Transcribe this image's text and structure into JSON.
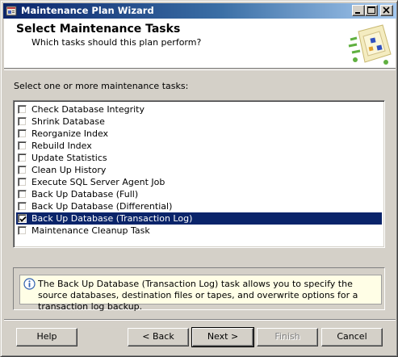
{
  "window": {
    "title": "Maintenance Plan Wizard"
  },
  "header": {
    "title": "Select Maintenance Tasks",
    "subtitle": "Which tasks should this plan perform?"
  },
  "task_list": {
    "label": "Select one or more maintenance tasks:",
    "items": [
      {
        "label": "Check Database Integrity",
        "checked": false,
        "selected": false
      },
      {
        "label": "Shrink Database",
        "checked": false,
        "selected": false
      },
      {
        "label": "Reorganize Index",
        "checked": false,
        "selected": false
      },
      {
        "label": "Rebuild Index",
        "checked": false,
        "selected": false
      },
      {
        "label": "Update Statistics",
        "checked": false,
        "selected": false
      },
      {
        "label": "Clean Up History",
        "checked": false,
        "selected": false
      },
      {
        "label": "Execute SQL Server Agent Job",
        "checked": false,
        "selected": false
      },
      {
        "label": "Back Up Database (Full)",
        "checked": false,
        "selected": false
      },
      {
        "label": "Back Up Database (Differential)",
        "checked": false,
        "selected": false
      },
      {
        "label": "Back Up Database (Transaction Log)",
        "checked": true,
        "selected": true
      },
      {
        "label": "Maintenance Cleanup Task",
        "checked": false,
        "selected": false
      }
    ]
  },
  "description": {
    "icon": "info-icon",
    "text": "The Back Up Database (Transaction Log) task allows you to specify the source databases, destination files or tapes, and overwrite options for a transaction log backup."
  },
  "buttons": {
    "help": "Help",
    "back": "< Back",
    "next": "Next >",
    "finish": "Finish",
    "cancel": "Cancel"
  },
  "colors": {
    "title_bar_start": "#0a246a",
    "title_bar_end": "#a6caf0",
    "selection": "#0a246a",
    "dialog_face": "#d4d0c8",
    "description_background": "#fffee6"
  }
}
